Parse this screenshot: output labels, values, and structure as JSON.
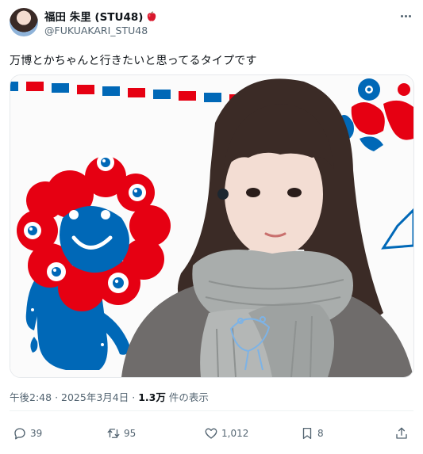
{
  "tweet": {
    "author": {
      "display_name": "福田 朱里 (STU48)",
      "handle": "@FUKUAKARI_STU48",
      "name_emoji_icon": "red-apple-icon"
    },
    "text": "万博とかちゃんと行きたいと思ってるタイプです",
    "meta": {
      "time": "午後2:48",
      "separator": "·",
      "date": "2025年3月4日",
      "views_count": "1.3万",
      "views_label": "件の表示"
    },
    "actions": {
      "reply": {
        "icon": "reply-icon",
        "count": "39"
      },
      "retweet": {
        "icon": "retweet-icon",
        "count": "95"
      },
      "like": {
        "icon": "heart-icon",
        "count": "1,012"
      },
      "bookmark": {
        "icon": "bookmark-icon",
        "count": "8"
      },
      "share": {
        "icon": "share-icon"
      }
    }
  },
  "colors": {
    "text_primary": "#0f1419",
    "text_secondary": "#536471",
    "mascot_red": "#e60012",
    "mascot_blue": "#0068b7"
  }
}
